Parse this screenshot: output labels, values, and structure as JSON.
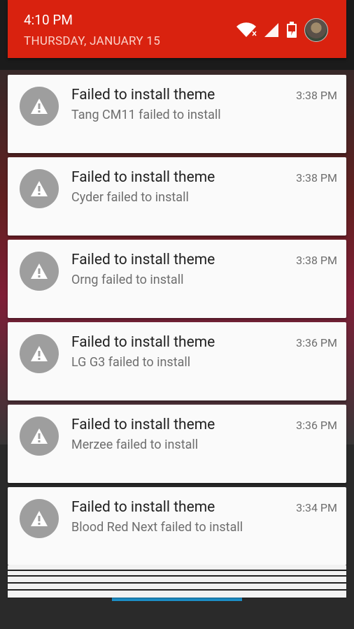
{
  "status": {
    "time": "4:10 PM",
    "date": "THURSDAY, JANUARY 15",
    "icons": [
      "wifi-icon",
      "signal-icon",
      "battery-charging-icon",
      "user-avatar"
    ]
  },
  "notifications": [
    {
      "title": "Failed to install theme",
      "text": "Tang CM11 failed to install",
      "time": "3:38 PM",
      "icon": "warning-icon"
    },
    {
      "title": "Failed to install theme",
      "text": "Cyder failed to install",
      "time": "3:38 PM",
      "icon": "warning-icon"
    },
    {
      "title": "Failed to install theme",
      "text": "Orng failed to install",
      "time": "3:38 PM",
      "icon": "warning-icon"
    },
    {
      "title": "Failed to install theme",
      "text": "LG G3 failed to install",
      "time": "3:36 PM",
      "icon": "warning-icon"
    },
    {
      "title": "Failed to install theme",
      "text": "Merzee failed to install",
      "time": "3:36 PM",
      "icon": "warning-icon"
    },
    {
      "title": "Failed to install theme",
      "text": "Blood Red Next failed to install",
      "time": "3:34 PM",
      "icon": "warning-icon"
    }
  ],
  "colors": {
    "header_bg": "#d9220f",
    "card_bg": "#fafafa",
    "icon_circle": "#9e9e9e"
  }
}
